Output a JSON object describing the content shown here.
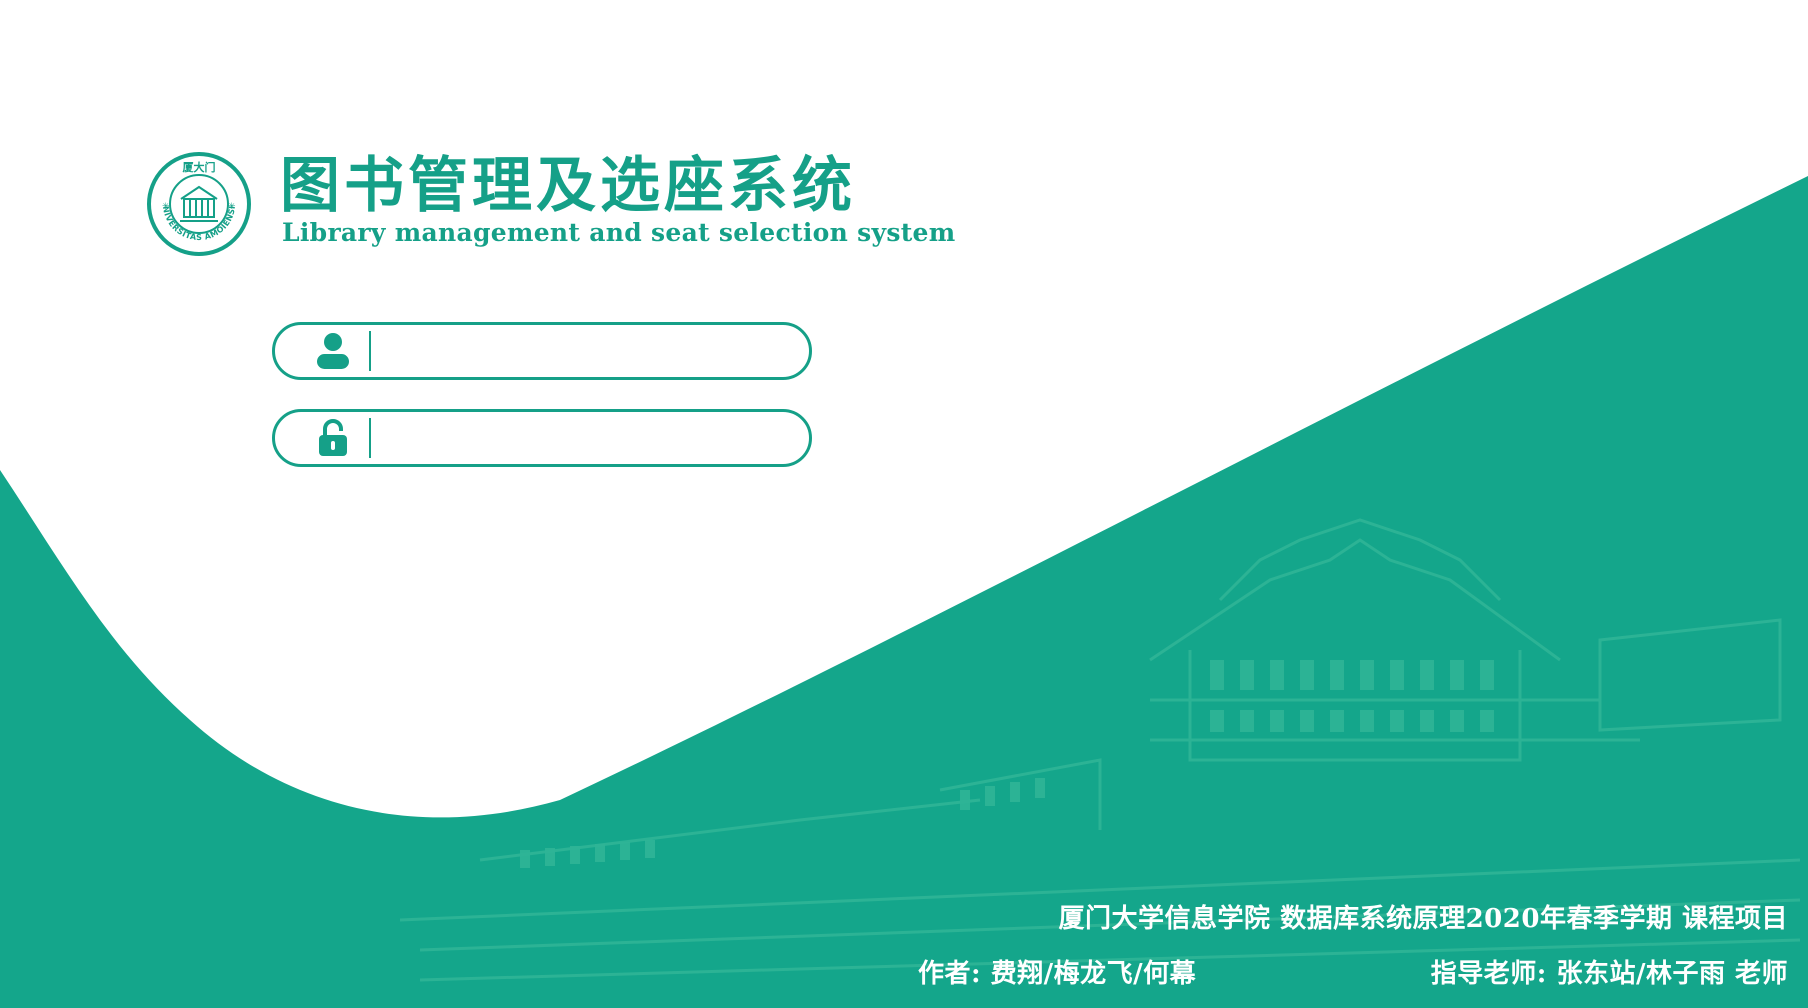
{
  "app": {
    "title_cn": "图书管理及选座系统",
    "title_en": "Library management and seat selection system"
  },
  "logo": {
    "top_text": "厦大门",
    "ring_text": "UNIVERSITAS AMOIENSIS"
  },
  "login": {
    "username": {
      "icon": "user-icon",
      "value": "",
      "placeholder": ""
    },
    "password": {
      "icon": "lock-icon",
      "value": "",
      "placeholder": ""
    }
  },
  "footer": {
    "line1": "厦门大学信息学院 数据库系统原理2020年春季学期 课程项目",
    "authors": "作者: 费翔/梅龙飞/何幕",
    "advisors": "指导老师: 张东站/林子雨 老师"
  },
  "colors": {
    "brand_green": "#15a088",
    "panel_green": "#14a68b",
    "building_tint": "#2aae93"
  }
}
